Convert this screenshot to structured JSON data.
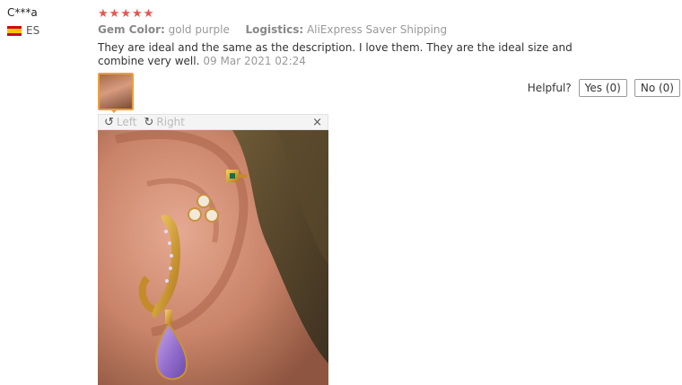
{
  "reviewer": {
    "name": "C***a",
    "country": "ES"
  },
  "review": {
    "stars": 5,
    "star_glyphs": [
      "★",
      "★",
      "★",
      "★",
      "★"
    ],
    "gem_label": "Gem Color:",
    "gem_value": "gold purple",
    "logistics_label": "Logistics:",
    "logistics_value": "AliExpress Saver Shipping",
    "text": "They are ideal and the same as the description. I love them. They are the ideal size and combine very well.",
    "date": "09 Mar 2021 02:24"
  },
  "helpful": {
    "label": "Helpful?",
    "yes": "Yes (0)",
    "no": "No (0)"
  },
  "viewer": {
    "rotate_left": "Left",
    "rotate_right": "Right",
    "close": "×"
  },
  "colors": {
    "star": "#e8554e",
    "accent": "#e8a23e",
    "flag_red": "#c60b1e",
    "flag_yellow": "#ffc400"
  }
}
